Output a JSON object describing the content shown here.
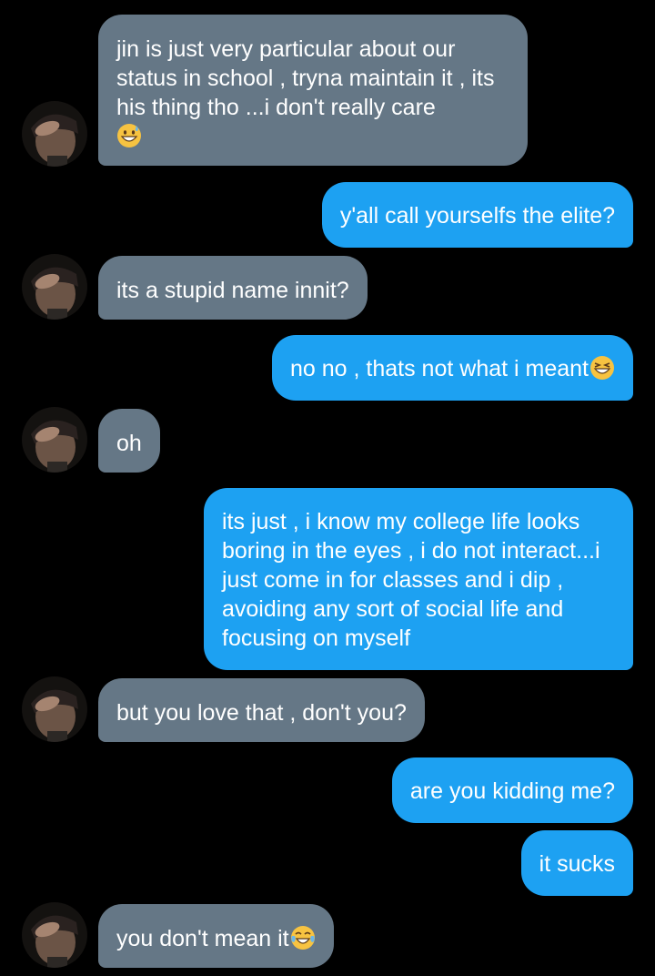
{
  "theme": {
    "background": "#000000",
    "received_bubble": "#657786",
    "sent_bubble": "#1da1f2",
    "text": "#ffffff"
  },
  "messages": [
    {
      "side": "received",
      "text": "jin is just very particular about our status in school , tryna maintain it , its his thing tho ...i don't really care",
      "emoji": "grinning-sweat-icon",
      "avatar": true
    },
    {
      "side": "sent",
      "text": "y'all call yourselfs the elite?"
    },
    {
      "side": "received",
      "text": "its a stupid name innit?",
      "avatar": true
    },
    {
      "side": "sent",
      "text": "no no , thats not what i meant",
      "emoji": "grinning-squint-icon"
    },
    {
      "side": "received",
      "text": "oh",
      "avatar": true
    },
    {
      "side": "sent",
      "text": "its just , i know my college life looks boring in the eyes , i do not interact...i just come in for classes and i dip , avoiding any sort of social life and focusing on myself"
    },
    {
      "side": "received",
      "text": "but you love that , don't you?",
      "avatar": true
    },
    {
      "side": "sent",
      "text": "are you kidding me?"
    },
    {
      "side": "sent",
      "text": "it sucks"
    },
    {
      "side": "received",
      "text": "you don't mean it",
      "emoji": "tears-of-joy-icon",
      "avatar": true
    }
  ]
}
